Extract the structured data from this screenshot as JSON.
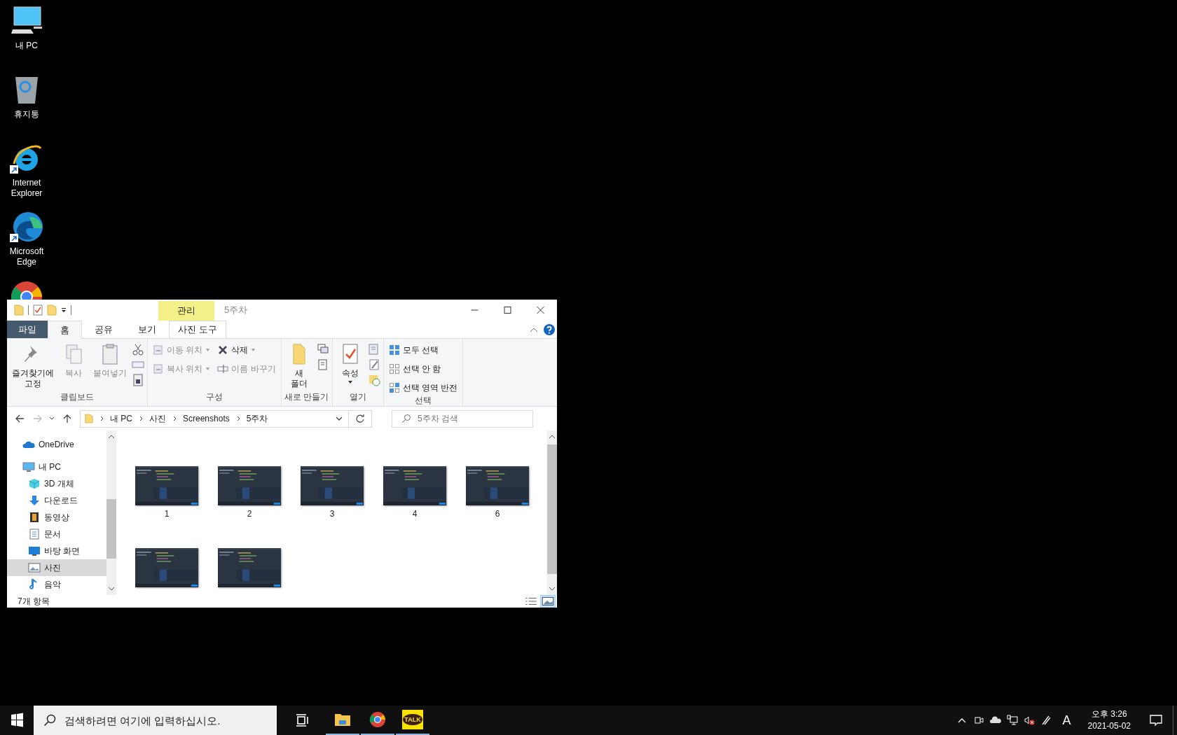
{
  "desktop_icons": [
    {
      "kind": "pc",
      "label": "내 PC",
      "shortcut": false
    },
    {
      "kind": "recycle",
      "label": "휴지통",
      "shortcut": false
    },
    {
      "kind": "ie",
      "label": "Internet Explorer",
      "shortcut": true
    },
    {
      "kind": "edge",
      "label": "Microsoft Edge",
      "shortcut": true
    },
    {
      "kind": "chrome",
      "shortcut": false
    }
  ],
  "window": {
    "title": "5주차",
    "context_group": "관리",
    "tabs": [
      {
        "label": "파일",
        "kind": "file",
        "selected": false
      },
      {
        "label": "홈",
        "kind": "tab",
        "selected": true
      },
      {
        "label": "공유",
        "kind": "tab",
        "selected": false
      },
      {
        "label": "보기",
        "kind": "tab",
        "selected": false
      },
      {
        "label": "사진 도구",
        "kind": "context",
        "selected": false
      }
    ],
    "ribbon": [
      {
        "label": "클립보드",
        "items": [
          {
            "kind": "big",
            "label": "즐겨찾기에\n고정",
            "disabled": false,
            "dropdown": false
          },
          {
            "kind": "big",
            "label": "복사",
            "disabled": true,
            "dropdown": false
          },
          {
            "kind": "big",
            "label": "붙여넣기",
            "disabled": true,
            "dropdown": false
          },
          {
            "kind": "icons"
          }
        ]
      },
      {
        "label": "구성",
        "items": [
          {
            "kind": "stack",
            "rows": [
              {
                "label": "이동 위치",
                "dropdown": true,
                "disabled": true
              },
              {
                "label": "복사 위치",
                "dropdown": true,
                "disabled": true
              }
            ]
          },
          {
            "kind": "stack",
            "rows": [
              {
                "label": "삭제",
                "dropdown": true,
                "disabled": false
              },
              {
                "label": "이름 바꾸기",
                "dropdown": false,
                "disabled": true
              }
            ]
          }
        ]
      },
      {
        "label": "새로 만들기",
        "items": [
          {
            "kind": "big",
            "label": "새\n폴더",
            "disabled": false,
            "dropdown": false
          },
          {
            "kind": "icons"
          }
        ]
      },
      {
        "label": "열기",
        "items": [
          {
            "kind": "big",
            "label": "속성",
            "disabled": false,
            "dropdown": true
          },
          {
            "kind": "icons"
          }
        ]
      },
      {
        "label": "선택",
        "items": [
          {
            "kind": "stack",
            "rows": [
              {
                "label": "모두 선택",
                "dropdown": false,
                "disabled": false
              },
              {
                "label": "선택 안 함",
                "dropdown": false,
                "disabled": false
              },
              {
                "label": "선택 영역 반전",
                "dropdown": false,
                "disabled": false
              }
            ]
          }
        ]
      }
    ],
    "path": [
      "내 PC",
      "사진",
      "Screenshots",
      "5주차"
    ],
    "search": {
      "placeholder": "5주차 검색"
    },
    "nav": [
      {
        "kind": "cloud",
        "label": "OneDrive",
        "selected": false
      },
      {
        "kind": "pc",
        "label": "내 PC",
        "selected": false,
        "children": [
          {
            "kind": "cube",
            "label": "3D 개체",
            "selected": false
          },
          {
            "kind": "download",
            "label": "다운로드",
            "selected": false
          },
          {
            "kind": "video",
            "label": "동영상",
            "selected": false
          },
          {
            "kind": "doc",
            "label": "문서",
            "selected": false
          },
          {
            "kind": "desktop",
            "label": "바탕 화면",
            "selected": false
          },
          {
            "label": "사진",
            "selected": true
          },
          {
            "kind": "music",
            "label": "음악",
            "selected": false
          }
        ]
      }
    ],
    "files": [
      {
        "kind": "picture",
        "name": "1"
      },
      {
        "kind": "picture",
        "name": "2"
      },
      {
        "kind": "picture",
        "name": "3"
      },
      {
        "kind": "picture",
        "name": "4"
      },
      {
        "kind": "picture",
        "name": "6"
      },
      {
        "kind": "picture"
      },
      {
        "kind": "picture"
      }
    ],
    "status": "7개 항목",
    "views": [
      {
        "kind": "details",
        "selected": false
      },
      {
        "kind": "large",
        "selected": true
      }
    ]
  },
  "taskbar": {
    "search_placeholder": "검색하려면 여기에 입력하십시오.",
    "apps": [
      {
        "kind": "explorer",
        "running": true
      },
      {
        "kind": "chrome",
        "running": true
      },
      {
        "kind": "kakao",
        "label": "TALK",
        "running": true
      }
    ],
    "ime": "A",
    "time": "오후 3:26",
    "date": "2021-05-02"
  }
}
